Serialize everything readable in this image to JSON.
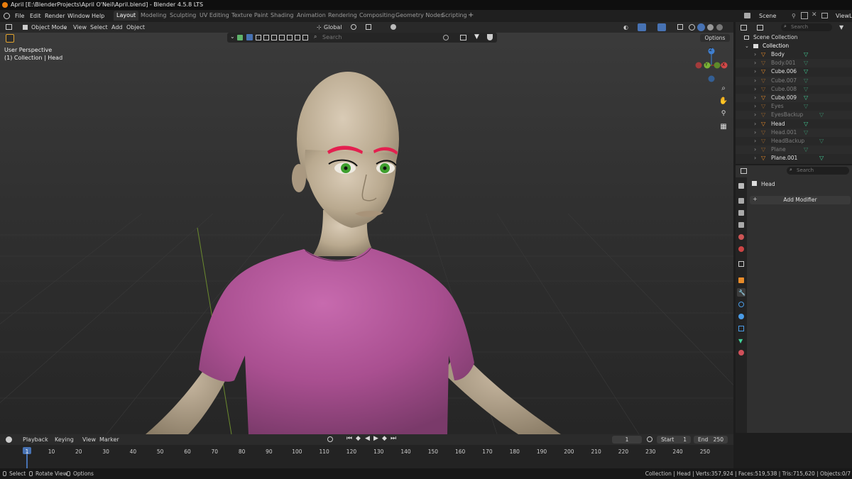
{
  "window": {
    "title": "April [E:\\BlenderProjects\\April O'Neil\\April.blend] - Blender 4.5.8 LTS"
  },
  "menu": [
    "File",
    "Edit",
    "Render",
    "Window",
    "Help"
  ],
  "workspaces": [
    "Layout",
    "Modeling",
    "Sculpting",
    "UV Editing",
    "Texture Paint",
    "Shading",
    "Animation",
    "Rendering",
    "Compositing",
    "Geometry Nodes",
    "Scripting"
  ],
  "active_workspace": "Layout",
  "scene": {
    "label": "Scene",
    "view_layer": "ViewLa"
  },
  "viewport_header": {
    "mode": "Object Mode",
    "menus": [
      "View",
      "Select",
      "Add",
      "Object"
    ],
    "transform_orientation": "Global",
    "options": "Options",
    "search_placeholder": "Search"
  },
  "viewport_overlay": {
    "perspective": "User Perspective",
    "collection": "(1) Collection | Head"
  },
  "gizmo": {
    "z": "Z",
    "y": "Y",
    "x": "X"
  },
  "outliner": {
    "search_placeholder": "Search",
    "root": "Scene Collection",
    "collection": "Collection",
    "items": [
      {
        "name": "Body",
        "dim": false
      },
      {
        "name": "Body.001",
        "dim": true
      },
      {
        "name": "Cube.006",
        "dim": false
      },
      {
        "name": "Cube.007",
        "dim": true
      },
      {
        "name": "Cube.008",
        "dim": true
      },
      {
        "name": "Cube.009",
        "dim": false
      },
      {
        "name": "Eyes",
        "dim": true
      },
      {
        "name": "EyesBackup",
        "dim": true
      },
      {
        "name": "Head",
        "dim": false
      },
      {
        "name": "Head.001",
        "dim": true
      },
      {
        "name": "HeadBackup",
        "dim": true
      },
      {
        "name": "Plane",
        "dim": true
      },
      {
        "name": "Plane.001",
        "dim": false
      }
    ]
  },
  "properties": {
    "search_placeholder": "Search",
    "object_name": "Head",
    "add_modifier": "Add Modifier"
  },
  "timeline": {
    "menus": [
      "Playback",
      "Keying",
      "View",
      "Marker"
    ],
    "current_frame": "1",
    "start_label": "Start",
    "start": "1",
    "end_label": "End",
    "end": "250",
    "ruler": [
      "1",
      "10",
      "20",
      "30",
      "40",
      "50",
      "60",
      "70",
      "80",
      "90",
      "100",
      "110",
      "120",
      "130",
      "140",
      "150",
      "160",
      "170",
      "180",
      "190",
      "200",
      "210",
      "220",
      "230",
      "240",
      "250"
    ]
  },
  "statusbar": {
    "select": "Select",
    "rotate": "Rotate View",
    "options": "Options",
    "stats": "Collection | Head | Verts:357,924 | Faces:519,538 | Tris:715,620 | Objects:0/7"
  },
  "colors": {
    "accent": "#4772b3",
    "shirt": "#b35a9b",
    "skin": "#c7b7a1",
    "eyebrow": "#e3204f",
    "iris": "#3f9f2e",
    "mesh_icon": "#e88c2a",
    "data_icon": "#43d39a"
  }
}
